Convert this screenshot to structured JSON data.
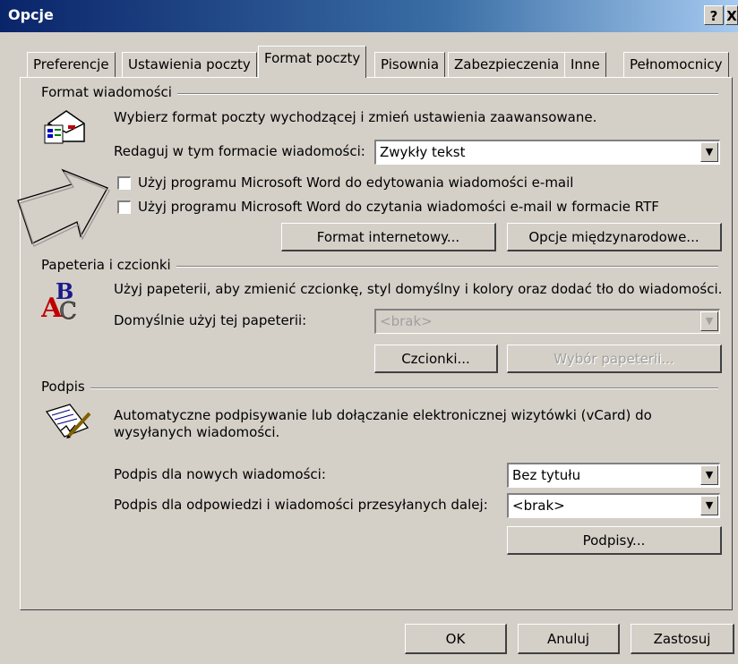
{
  "window": {
    "title": "Opcje",
    "help_label": "?",
    "close_label": "X"
  },
  "tabs": [
    {
      "label": "Preferencje"
    },
    {
      "label": "Ustawienia poczty"
    },
    {
      "label": "Format poczty"
    },
    {
      "label": "Pisownia"
    },
    {
      "label": "Zabezpieczenia"
    },
    {
      "label": "Inne"
    },
    {
      "label": "Pełnomocnicy"
    }
  ],
  "format": {
    "group_label": "Format wiadomości",
    "description": "Wybierz format poczty wychodzącej i zmień ustawienia zaawansowane.",
    "compose_label": "Redaguj w tym formacie wiadomości:",
    "compose_value": "Zwykły tekst",
    "word_edit_label": "Użyj programu Microsoft Word do edytowania wiadomości e-mail",
    "word_read_label": "Użyj programu Microsoft Word do czytania wiadomości e-mail w formacie RTF",
    "internet_format_button": "Format internetowy...",
    "international_options_button": "Opcje międzynarodowe..."
  },
  "stationery": {
    "group_label": "Papeteria i czcionki",
    "description": "Użyj papeterii, aby zmienić czcionkę, styl domyślny i kolory oraz dodać tło do wiadomości.",
    "default_label": "Domyślnie użyj tej papeterii:",
    "default_value": "<brak>",
    "fonts_button": "Czcionki...",
    "picker_button": "Wybór papeterii..."
  },
  "signature": {
    "group_label": "Podpis",
    "description_line1": "Automatyczne podpisywanie lub dołączanie elektronicznej wizytówki (vCard) do",
    "description_line2": "wysyłanych wiadomości.",
    "new_label": "Podpis dla nowych wiadomości:",
    "new_value": "Bez tytułu",
    "reply_label": "Podpis dla odpowiedzi i wiadomości przesyłanych dalej:",
    "reply_value": "<brak>",
    "signatures_button": "Podpisy..."
  },
  "footer": {
    "ok": "OK",
    "cancel": "Anuluj",
    "apply": "Zastosuj"
  }
}
